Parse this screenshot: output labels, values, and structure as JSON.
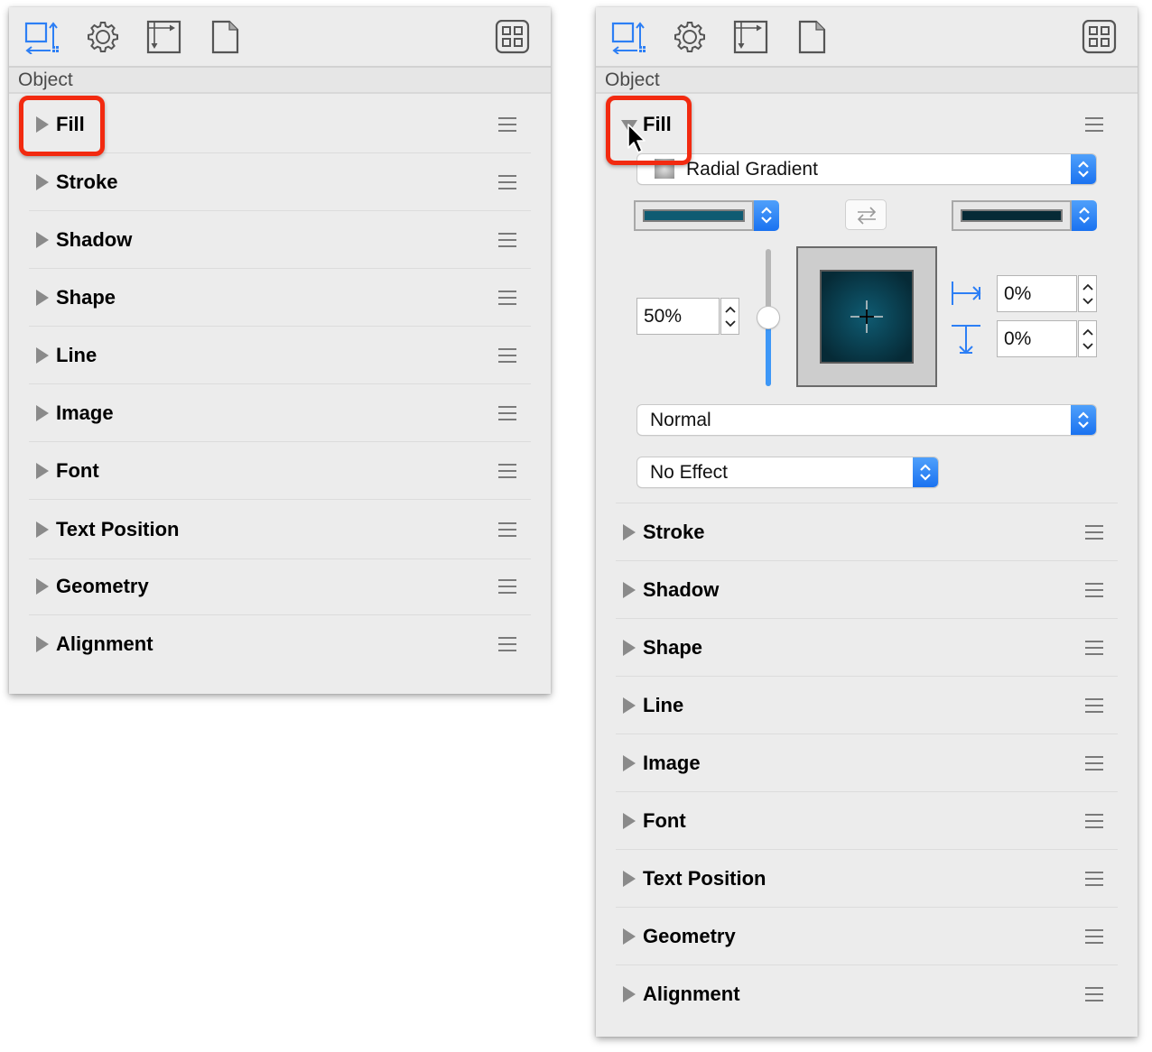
{
  "toolbar": {
    "icons": [
      {
        "name": "object-inspector-icon",
        "active": true
      },
      {
        "name": "properties-gear-icon",
        "active": false
      },
      {
        "name": "canvas-layout-icon",
        "active": false
      },
      {
        "name": "document-icon",
        "active": false
      },
      {
        "name": "grid-view-icon",
        "active": false
      }
    ]
  },
  "section_title": "Object",
  "colors": {
    "accent": "#2d7ff5",
    "panel_bg": "#ececec",
    "highlight": "#f22a10",
    "gradient_start": "#0f5b72",
    "gradient_end": "#062a36"
  },
  "left_panel": {
    "state": "collapsed",
    "rows": [
      {
        "label": "Fill",
        "expanded": false,
        "highlighted": true
      },
      {
        "label": "Stroke",
        "expanded": false
      },
      {
        "label": "Shadow",
        "expanded": false
      },
      {
        "label": "Shape",
        "expanded": false
      },
      {
        "label": "Line",
        "expanded": false
      },
      {
        "label": "Image",
        "expanded": false
      },
      {
        "label": "Font",
        "expanded": false
      },
      {
        "label": "Text Position",
        "expanded": false
      },
      {
        "label": "Geometry",
        "expanded": false
      },
      {
        "label": "Alignment",
        "expanded": false
      }
    ]
  },
  "right_panel": {
    "state": "fill-expanded",
    "fill": {
      "label": "Fill",
      "expanded": true,
      "highlighted": true,
      "fill_type": "Radial Gradient",
      "start_color": "#0f5b72",
      "end_color": "#062a36",
      "midpoint_value": "50%",
      "midpoint_slider_fraction": 0.5,
      "x_offset": "0%",
      "y_offset": "0%",
      "blend_mode": "Normal",
      "effect": "No Effect"
    },
    "rows": [
      {
        "label": "Stroke",
        "expanded": false
      },
      {
        "label": "Shadow",
        "expanded": false
      },
      {
        "label": "Shape",
        "expanded": false
      },
      {
        "label": "Line",
        "expanded": false
      },
      {
        "label": "Image",
        "expanded": false
      },
      {
        "label": "Font",
        "expanded": false
      },
      {
        "label": "Text Position",
        "expanded": false
      },
      {
        "label": "Geometry",
        "expanded": false
      },
      {
        "label": "Alignment",
        "expanded": false
      }
    ]
  }
}
